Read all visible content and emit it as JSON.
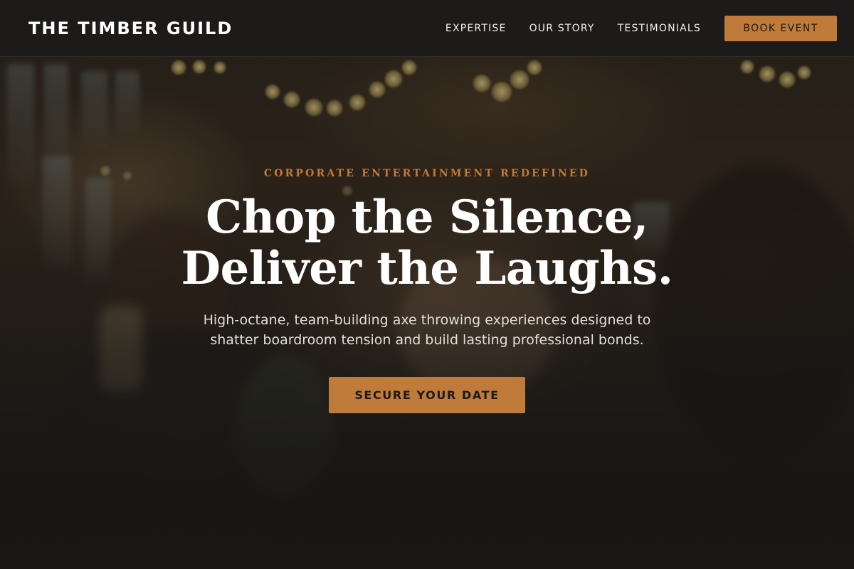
{
  "brand": {
    "name": "THE TIMBER GUILD"
  },
  "nav": {
    "items": [
      {
        "label": "EXPERTISE"
      },
      {
        "label": "OUR STORY"
      },
      {
        "label": "TESTIMONIALS"
      }
    ],
    "cta_label": "BOOK EVENT"
  },
  "hero": {
    "eyebrow": "CORPORATE ENTERTAINMENT REDEFINED",
    "headline_line1": "Chop the Silence,",
    "headline_line2": "Deliver the Laughs.",
    "subtitle_line1": "High-octane, team-building axe throwing experiences designed to",
    "subtitle_line2": "shatter boardroom tension and build lasting professional bonds.",
    "cta_label": "SECURE YOUR DATE",
    "background_image": "dim photo of people toasting at an event with string lights"
  },
  "colors": {
    "accent": "#c07a3a",
    "header_bg": "#1c1b1a",
    "text_primary": "#ffffff",
    "page_bg": "#1a1816"
  }
}
